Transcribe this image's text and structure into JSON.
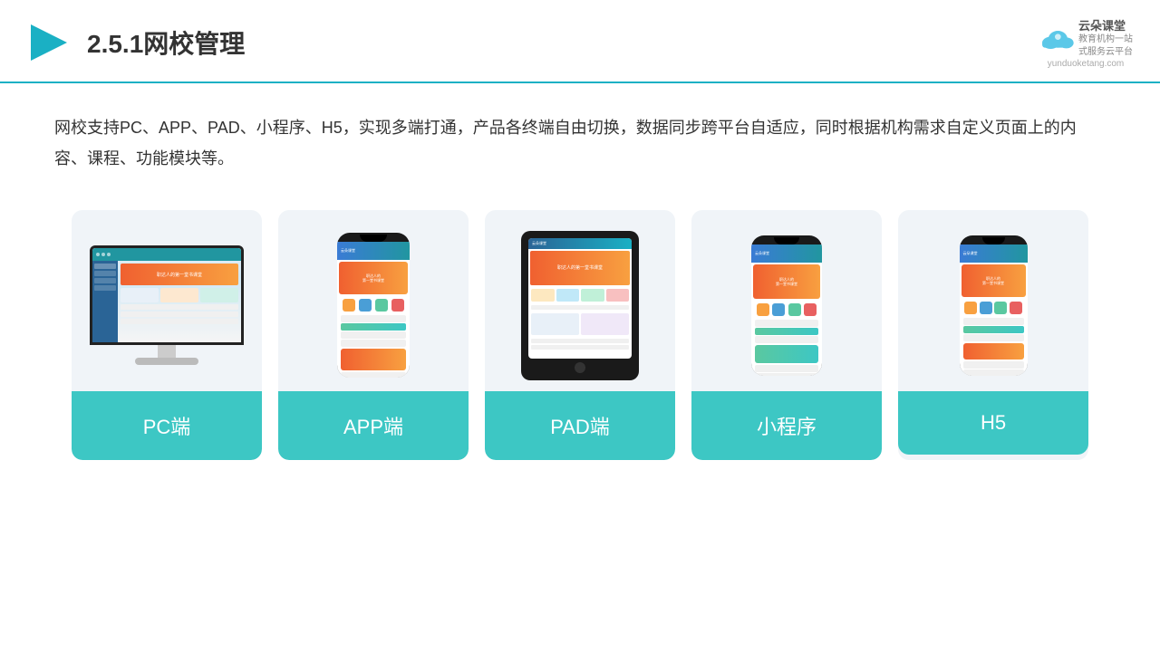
{
  "header": {
    "title": "2.5.1网校管理",
    "logo": {
      "name": "云朵课堂",
      "url": "yunduoketang.com",
      "tagline": "教育机构一站\n式服务云平台"
    }
  },
  "description": {
    "text": "网校支持PC、APP、PAD、小程序、H5，实现多端打通，产品各终端自由切换，数据同步跨平台自适应，同时根据机构需求自定义页面上的内容、课程、功能模块等。"
  },
  "cards": [
    {
      "id": "pc",
      "label": "PC端"
    },
    {
      "id": "app",
      "label": "APP端"
    },
    {
      "id": "pad",
      "label": "PAD端"
    },
    {
      "id": "miniprogram",
      "label": "小程序"
    },
    {
      "id": "h5",
      "label": "H5"
    }
  ],
  "colors": {
    "accent": "#3dc7c4",
    "headerBorder": "#1ab0c4",
    "darkText": "#333333"
  }
}
